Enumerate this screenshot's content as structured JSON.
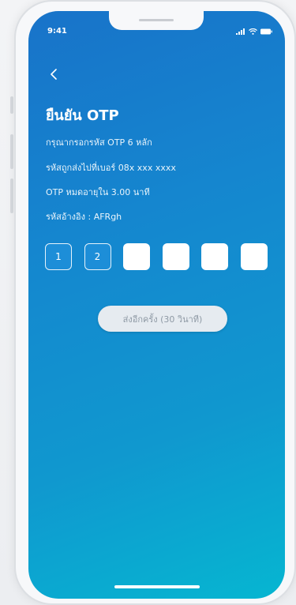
{
  "status_bar": {
    "time": "9:41",
    "icons": [
      "signal-icon",
      "wifi-icon",
      "battery-icon"
    ]
  },
  "header": {
    "back_icon": "chevron-left-icon",
    "title": "ยืนยัน OTP"
  },
  "info": {
    "instruction": "กรุณากรอกรหัส OTP 6 หลัก",
    "sent_to": "รหัสถูกส่งไปที่เบอร์ 08x xxx xxxx",
    "expiry": "OTP หมดอายุใน 3.00 นาที",
    "reference": "รหัสอ้างอิง : AFRgh"
  },
  "otp": {
    "digits": [
      "1",
      "2",
      "",
      "",
      "",
      ""
    ]
  },
  "resend": {
    "label": "ส่งอีกครั้ง (30 วินาที)"
  },
  "colors": {
    "gradient_start": "#1873c9",
    "gradient_end": "#06b6d1",
    "filled_box": "#1d8ed8",
    "resend_bg": "#e6ebf0",
    "resend_text": "#8f9aa5"
  }
}
